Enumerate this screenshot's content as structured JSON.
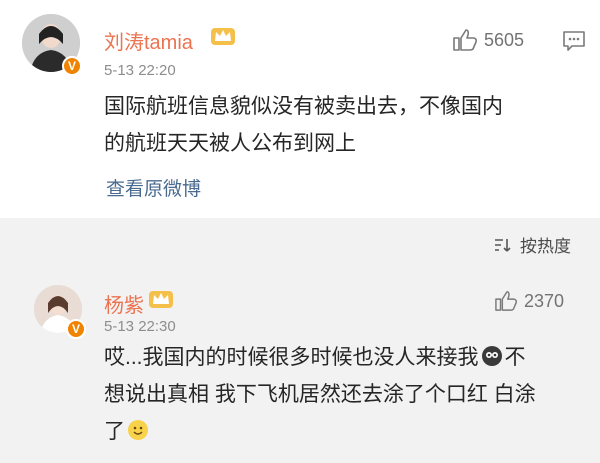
{
  "post": {
    "username": "刘涛tamia",
    "time": "5-13 22:20",
    "likes": "5605",
    "text_line1": "国际航班信息貌似没有被卖出去，不像国内",
    "text_line2": "的航班天天被人公布到网上",
    "view_original": "查看原微博",
    "badge": "V"
  },
  "sort": {
    "label": "按热度"
  },
  "reply": {
    "username": "杨紫",
    "time": "5-13 22:30",
    "likes": "2370",
    "text_line1_a": "哎...我国内的时候很多时候也没人来接我",
    "text_line1_b": "不",
    "text_line2": "想说出真相 我下飞机居然还去涂了个口红 白涂",
    "text_line3": "了",
    "badge": "V"
  },
  "colors": {
    "username": "#eb7350",
    "link": "#4a6b8f",
    "badge": "#f08300"
  }
}
